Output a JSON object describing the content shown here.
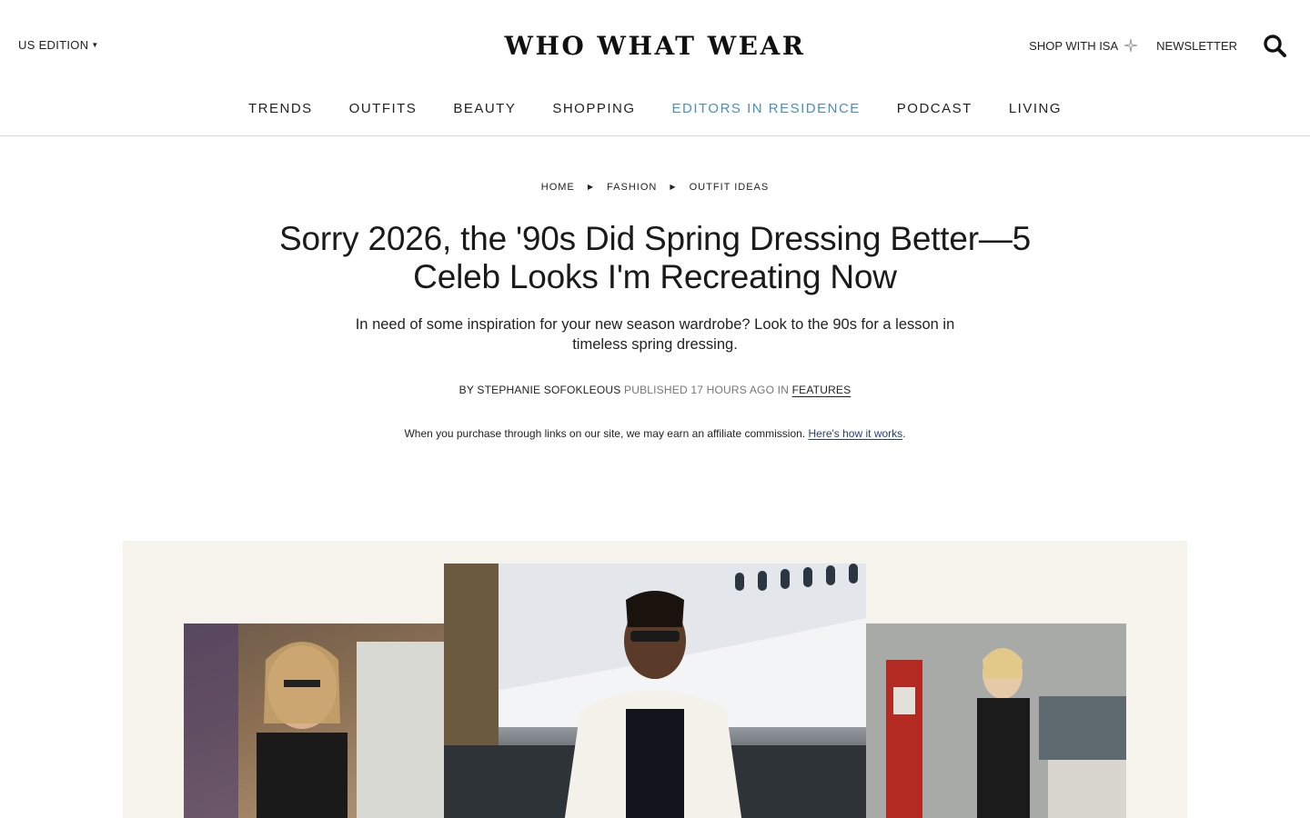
{
  "header": {
    "edition": "US EDITION",
    "logo": "WHO WHAT WEAR",
    "shop_link": "SHOP WITH ISA",
    "newsletter": "NEWSLETTER"
  },
  "nav": {
    "items": [
      {
        "label": "TRENDS"
      },
      {
        "label": "OUTFITS"
      },
      {
        "label": "BEAUTY"
      },
      {
        "label": "SHOPPING"
      },
      {
        "label": "EDITORS IN RESIDENCE"
      },
      {
        "label": "PODCAST"
      },
      {
        "label": "LIVING"
      }
    ]
  },
  "breadcrumb": [
    "HOME",
    "FASHION",
    "OUTFIT IDEAS"
  ],
  "article": {
    "title": "Sorry 2026, the '90s Did Spring Dressing Better—5 Celeb Looks I'm Recreating Now",
    "dek": "In need of some inspiration for your new season wardrobe? Look to the 90s for a lesson in timeless spring dressing.",
    "byline_prefix": "BY",
    "author": "STEPHANIE SOFOKLEOUS",
    "published": "PUBLISHED 17 HOURS AGO",
    "in_label": "IN",
    "category": "FEATURES",
    "disclaimer": "When you purchase through links on our site, we may earn an affiliate commission.",
    "disclaimer_link": "Here's how it works",
    "disclaimer_end": "."
  },
  "colors": {
    "accent_nav": "#4a90b8",
    "link": "#2a3d73",
    "hero_bg": "#f6f2ec"
  }
}
